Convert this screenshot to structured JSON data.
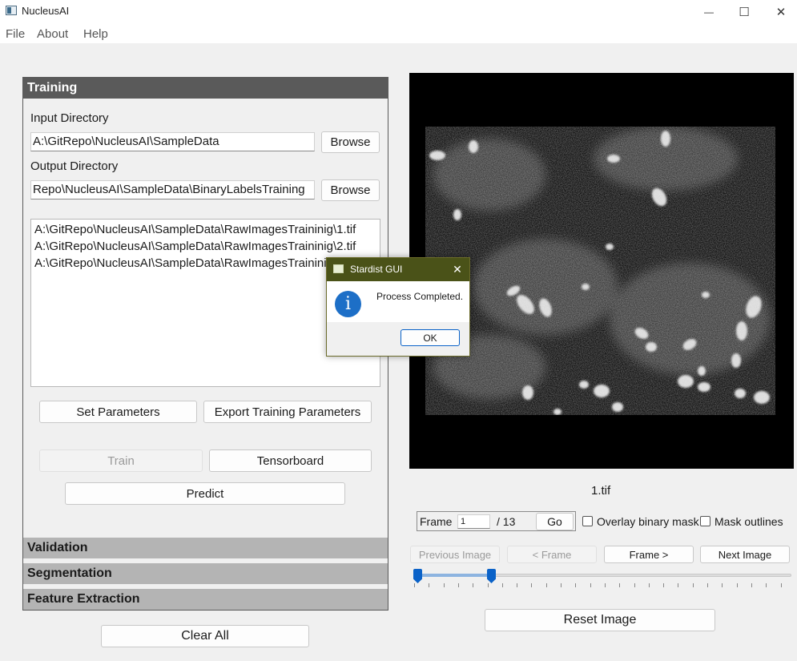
{
  "window": {
    "title": "NucleusAI",
    "minimize_glyph": "—",
    "maximize_glyph": "☐",
    "close_glyph": "✕"
  },
  "menu": [
    "File",
    "About",
    "Help"
  ],
  "training": {
    "header": "Training",
    "input_label": "Input Directory",
    "input_value": "A:\\GitRepo\\NucleusAI\\SampleData",
    "output_label": "Output Directory",
    "output_value": "Repo\\NucleusAI\\SampleData\\BinaryLabelsTraining",
    "browse_label": "Browse",
    "files": [
      "A:\\GitRepo\\NucleusAI\\SampleData\\RawImagesTraininig\\1.tif",
      "A:\\GitRepo\\NucleusAI\\SampleData\\RawImagesTraininig\\2.tif",
      "A:\\GitRepo\\NucleusAI\\SampleData\\RawImagesTraininig\\3.tif"
    ],
    "set_parameters": "Set Parameters",
    "export_parameters": "Export Training Parameters",
    "train": "Train",
    "tensorboard": "Tensorboard",
    "predict": "Predict"
  },
  "sections": {
    "validation": "Validation",
    "segmentation": "Segmentation",
    "feature_extraction": "Feature Extraction"
  },
  "clear_all": "Clear All",
  "viewer": {
    "filename": "1.tif",
    "frame_label": "Frame",
    "frame_value": "1",
    "frame_total": "/ 13",
    "go": "Go",
    "overlay_label": "Overlay binary mask",
    "outlines_label": "Mask outlines",
    "prev_image": "Previous Image",
    "prev_frame": "< Frame",
    "next_frame": "Frame >",
    "next_image": "Next Image",
    "reset_image": "Reset Image"
  },
  "dialog": {
    "title": "Stardist GUI",
    "message": "Process Completed.",
    "ok": "OK",
    "icon_glyph": "i"
  },
  "colors": {
    "dialog_titlebar": "#4a5218",
    "slider_handle": "#0a62c8",
    "header_active": "#5a5a5a",
    "header_inactive": "#b4b4b4"
  }
}
